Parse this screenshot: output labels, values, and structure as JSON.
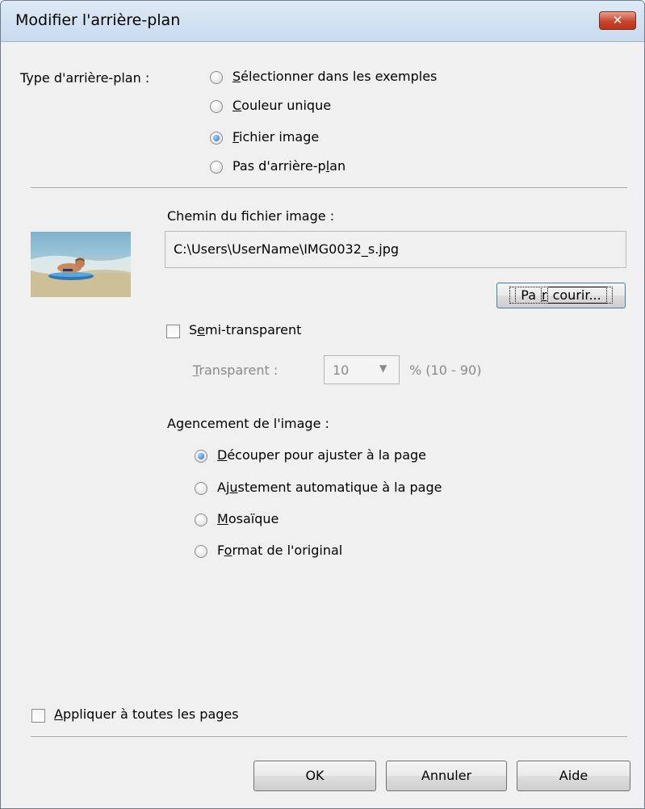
{
  "window": {
    "title": "Modifier l'arrière-plan",
    "close_glyph": "✕"
  },
  "background_type": {
    "label": "Type d'arrière-plan :",
    "options": [
      {
        "key": "S",
        "rest": "électionner dans les exemples",
        "checked": false
      },
      {
        "key": "C",
        "rest": "ouleur unique",
        "checked": false
      },
      {
        "key": "F",
        "rest": "ichier image",
        "checked": true
      },
      {
        "pre": "Pas d'arrière-p",
        "key": "l",
        "rest": "an",
        "checked": false
      }
    ]
  },
  "image_file": {
    "path_label": "Chemin du fichier image :",
    "path_value": "C:\\Users\\UserName\\IMG0032_s.jpg",
    "browse": {
      "pre": "Pa",
      "key": "r",
      "rest": "courir..."
    }
  },
  "semi_transparent": {
    "pre": "S",
    "key": "e",
    "rest": "mi-transparent",
    "checked": false,
    "transparent_label_key": "T",
    "transparent_label_rest": "ransparent :",
    "value": "10",
    "range": "% (10 - 90)"
  },
  "layout": {
    "label": "Agencement de l'image :",
    "options": [
      {
        "key": "D",
        "rest": "écouper pour ajuster à la page",
        "checked": true
      },
      {
        "pre": "Aj",
        "key": "u",
        "rest": "stement automatique à la page",
        "checked": false
      },
      {
        "key": "M",
        "rest": "osaïque",
        "checked": false
      },
      {
        "pre": "F",
        "key": "o",
        "rest": "rmat de l'original",
        "checked": false
      }
    ]
  },
  "apply_all": {
    "key": "A",
    "rest": "ppliquer à toutes les pages",
    "checked": false
  },
  "buttons": {
    "ok": "OK",
    "cancel": "Annuler",
    "help": "Aide"
  }
}
